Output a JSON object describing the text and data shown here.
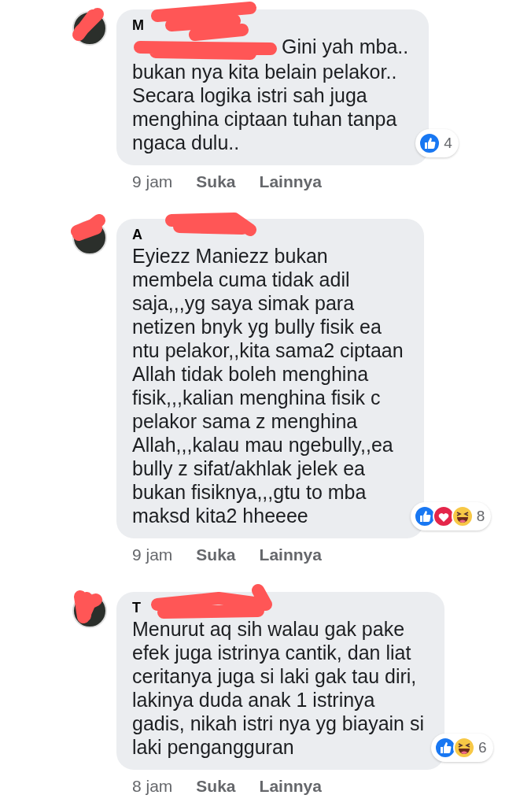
{
  "comments": [
    {
      "author": "M",
      "redacted": true,
      "redacted_mention": true,
      "lines": [
        "Gini yah mba..",
        "bukan nya kita belain pelakor..",
        "Secara logika istri sah juga",
        "menghina ciptaan tuhan tanpa",
        "ngaca dulu.."
      ],
      "reactions": [
        {
          "kind": "like"
        }
      ],
      "reaction_count": "4",
      "time": "9 jam",
      "like_label": "Suka",
      "more_label": "Lainnya"
    },
    {
      "author": "A",
      "redacted": true,
      "redacted_mention": false,
      "lines": [
        "Eyiezz Maniezz bukan",
        "membela cuma tidak adil",
        "saja,,,yg saya simak para",
        "netizen bnyk yg bully fisik ea",
        "ntu pelakor,,kita sama2 ciptaan",
        "Allah tidak boleh menghina",
        "fisik,,,kalian menghina fisik c",
        "pelakor sama z menghina",
        "Allah,,,kalau mau ngebully,,ea",
        "bully z sifat/akhlak jelek ea",
        "bukan fisiknya,,,gtu to mba",
        "maksd kita2 hheeee"
      ],
      "reactions": [
        {
          "kind": "like"
        },
        {
          "kind": "love"
        },
        {
          "kind": "haha"
        }
      ],
      "reaction_count": "8",
      "time": "9 jam",
      "like_label": "Suka",
      "more_label": "Lainnya"
    },
    {
      "author": "T",
      "redacted": true,
      "redacted_mention": false,
      "lines": [
        "Menurut aq sih walau gak pake",
        "efek juga istrinya cantik, dan liat",
        "ceritanya juga si laki gak tau diri,",
        "lakinya duda anak 1 istrinya",
        "gadis, nikah istri nya yg biayain si",
        "laki pengangguran"
      ],
      "reactions": [
        {
          "kind": "like"
        },
        {
          "kind": "haha"
        }
      ],
      "reaction_count": "6",
      "time": "8 jam",
      "like_label": "Suka",
      "more_label": "Lainnya"
    }
  ]
}
